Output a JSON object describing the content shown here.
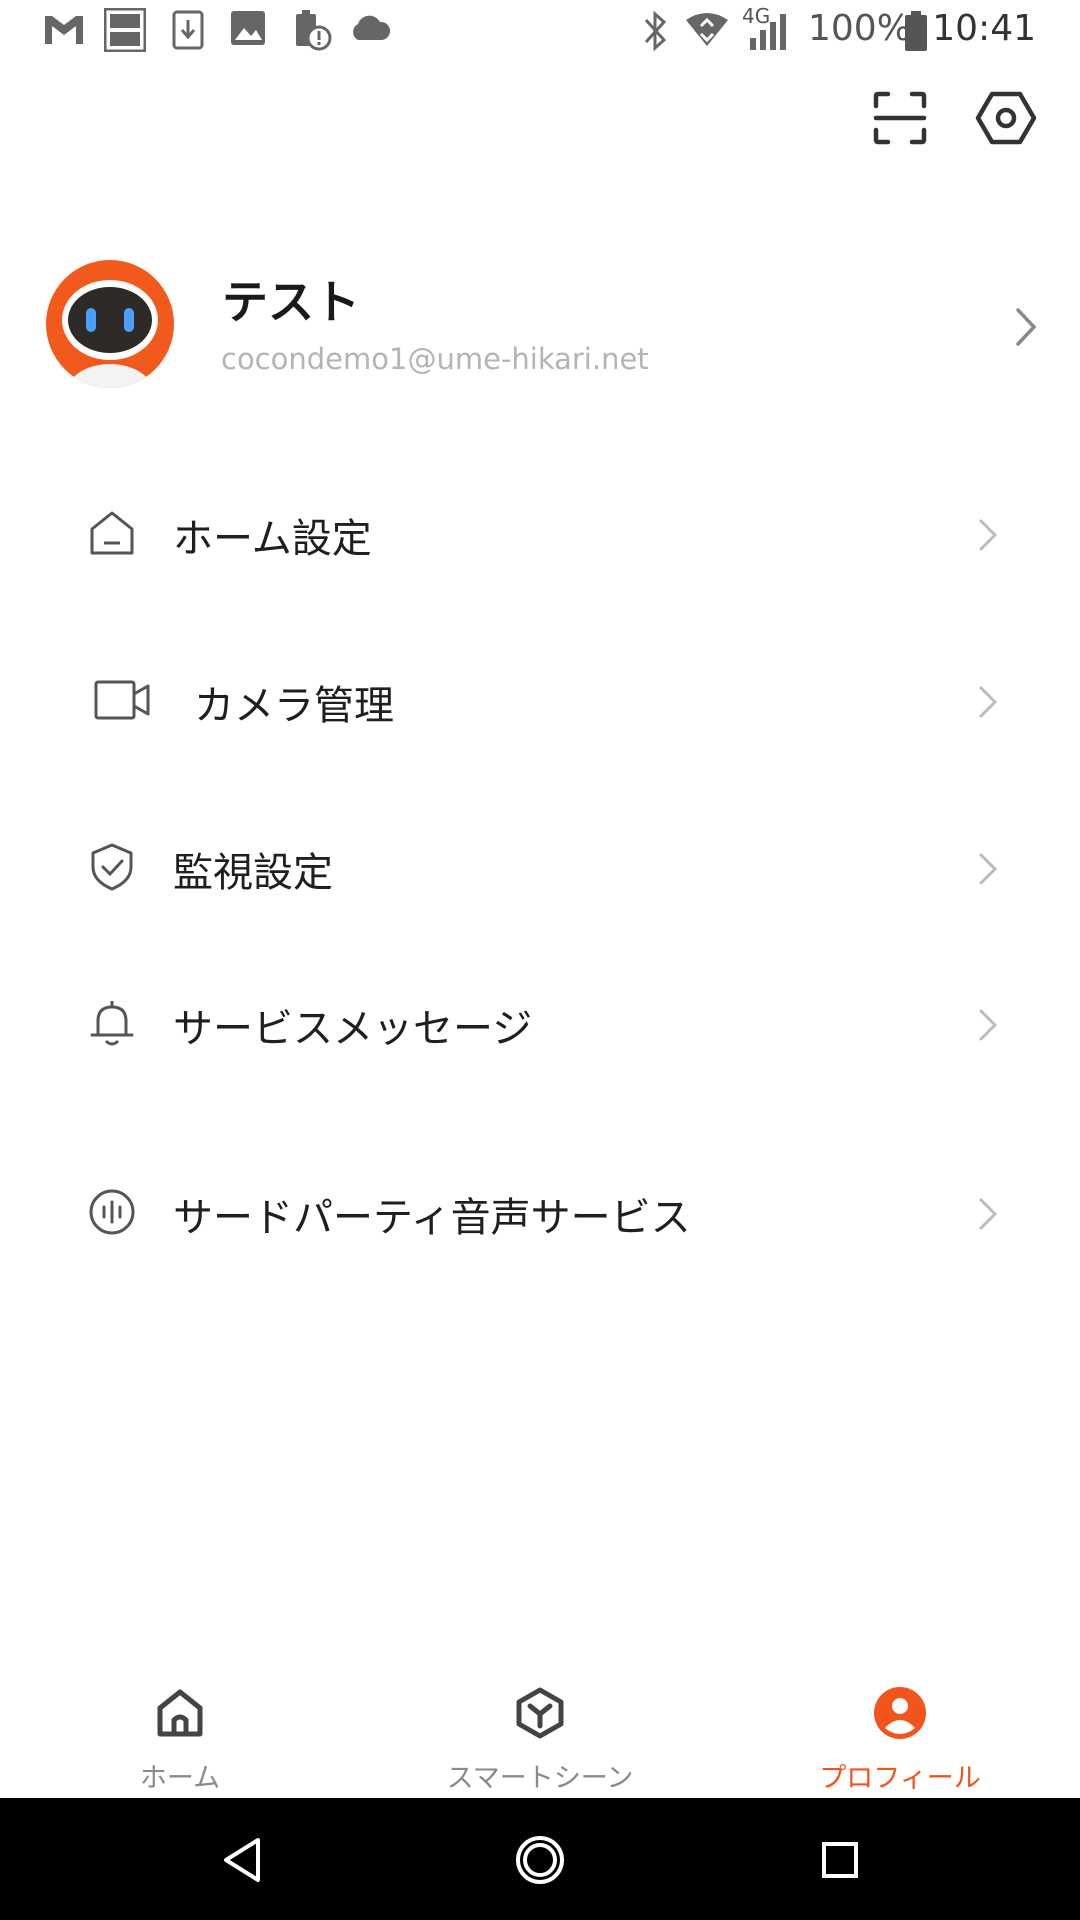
{
  "status_bar": {
    "battery_percent": "100%",
    "network_label": "4G",
    "time": "10:41",
    "icons": [
      "gmail-icon",
      "iconit-icon",
      "download-icon",
      "image-icon",
      "battery-alert-icon",
      "cloud-icon",
      "bluetooth-icon",
      "wifi-icon",
      "signal-icon",
      "battery-icon"
    ]
  },
  "header": {
    "scan_icon": "scan-icon",
    "settings_icon": "settings-hexagon-icon"
  },
  "profile": {
    "name": "テスト",
    "email": "cocondemo1@ume-hikari.net"
  },
  "menu": {
    "items": [
      {
        "icon": "home-icon",
        "label": "ホーム設定"
      },
      {
        "icon": "camera-icon",
        "label": "カメラ管理"
      },
      {
        "icon": "shield-check-icon",
        "label": "監視設定"
      },
      {
        "icon": "bell-icon",
        "label": "サービスメッセージ"
      },
      {
        "icon": "voice-icon",
        "label": "サードパーティ音声サービス"
      }
    ]
  },
  "bottom_nav": {
    "tabs": [
      {
        "label": "ホーム",
        "icon": "home-icon",
        "active": false
      },
      {
        "label": "スマートシーン",
        "icon": "scene-cube-icon",
        "active": false
      },
      {
        "label": "プロフィール",
        "icon": "profile-icon",
        "active": true
      }
    ]
  },
  "colors": {
    "accent": "#f2541e",
    "text_primary": "#1f1f1f",
    "text_secondary": "#b4b4b4",
    "inactive": "#8a8a8a"
  }
}
